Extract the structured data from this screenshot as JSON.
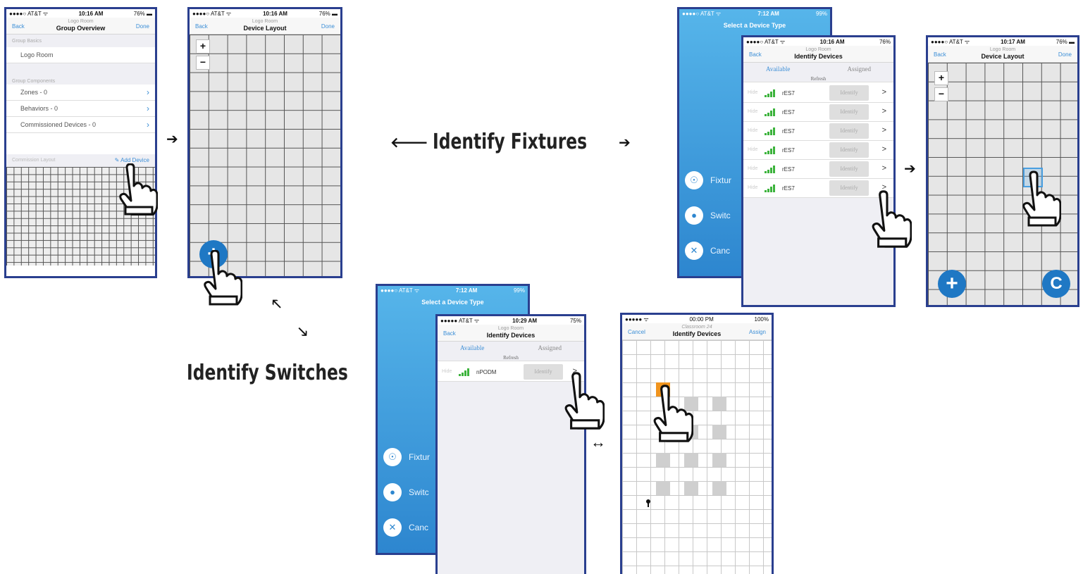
{
  "labels": {
    "identify_fixtures": "Identify Fixtures",
    "identify_switches": "Identify Switches"
  },
  "arrows": {
    "right": "➔",
    "left": "🡐",
    "up_left": "🡔",
    "down_right": "🡖",
    "both": "↔"
  },
  "screen1": {
    "carrier": "●●●●○ AT&T ᯤ",
    "time": "10:16 AM",
    "battery": "76% ▬",
    "back": "Back",
    "subtitle": "Logo Room",
    "title": "Group Overview",
    "done": "Done",
    "group_basics_header": "Group Basics",
    "room_name": "Logo Room",
    "group_components_header": "Group Components",
    "zones": "Zones - 0",
    "behaviors": "Behaviors - 0",
    "commissioned": "Commissioned Devices - 0",
    "commission_layout_header": "Commission Layout",
    "add_device": "Add Device"
  },
  "screen2": {
    "carrier": "●●●●○ AT&T ᯤ",
    "time": "10:16 AM",
    "battery": "76% ▬",
    "back": "Back",
    "subtitle": "Logo Room",
    "title": "Device Layout",
    "done": "Done",
    "zoom_in": "+",
    "zoom_out": "−",
    "add": "+"
  },
  "screen3_back": {
    "carrier": "●●●●○ AT&T ᯤ",
    "time": "7:12 AM",
    "battery": "99%",
    "title": "Select a Device Type",
    "opt1": "Fixtur",
    "opt2": "Switc",
    "opt3": "Canc"
  },
  "screen3": {
    "carrier": "●●●●○ AT&T ᯤ",
    "time": "10:16 AM",
    "battery": "76%",
    "back": "Back",
    "subtitle": "Logo Room",
    "title": "Identify Devices",
    "tab_available": "Available",
    "tab_assigned": "Assigned",
    "refresh": "Refresh",
    "devices": [
      {
        "hide": "Hide",
        "name": "rES7",
        "button": "Identify",
        "chev": ">"
      },
      {
        "hide": "Hide",
        "name": "rES7",
        "button": "Identify",
        "chev": ">"
      },
      {
        "hide": "Hide",
        "name": "rES7",
        "button": "Identify",
        "chev": ">"
      },
      {
        "hide": "Hide",
        "name": "rES7",
        "button": "Identify",
        "chev": ">"
      },
      {
        "hide": "Hide",
        "name": "rES7",
        "button": "Identify",
        "chev": ">"
      },
      {
        "hide": "Hide",
        "name": "rES7",
        "button": "Identify",
        "chev": ">"
      }
    ]
  },
  "screen4": {
    "carrier": "●●●●○ AT&T ᯤ",
    "time": "10:17 AM",
    "battery": "76% ▬",
    "back": "Back",
    "subtitle": "Logo Room",
    "title": "Device Layout",
    "done": "Done",
    "zoom_in": "+",
    "zoom_out": "−",
    "add": "+",
    "refresh": "C"
  },
  "screen5_back": {
    "carrier": "●●●●○ AT&T ᯤ",
    "time": "7:12 AM",
    "battery": "99%",
    "title": "Select a Device Type",
    "opt1": "Fixtur",
    "opt2": "Switc",
    "opt3": "Canc"
  },
  "screen5": {
    "carrier": "●●●●● AT&T ᯤ",
    "time": "10:29 AM",
    "battery": "75%",
    "back": "Back",
    "subtitle": "Logo Room",
    "title": "Identify Devices",
    "tab_available": "Available",
    "tab_assigned": "Assigned",
    "refresh": "Refresh",
    "device": {
      "hide": "Hide",
      "name": "nPODM",
      "button": "Identify",
      "chev": ">"
    }
  },
  "screen6": {
    "carrier": "●●●●● ᯤ",
    "time": "00:00 PM",
    "battery": "100%",
    "cancel": "Cancel",
    "subtitle": "Classroom 24",
    "title": "Identify Devices",
    "assign": "Assign"
  }
}
